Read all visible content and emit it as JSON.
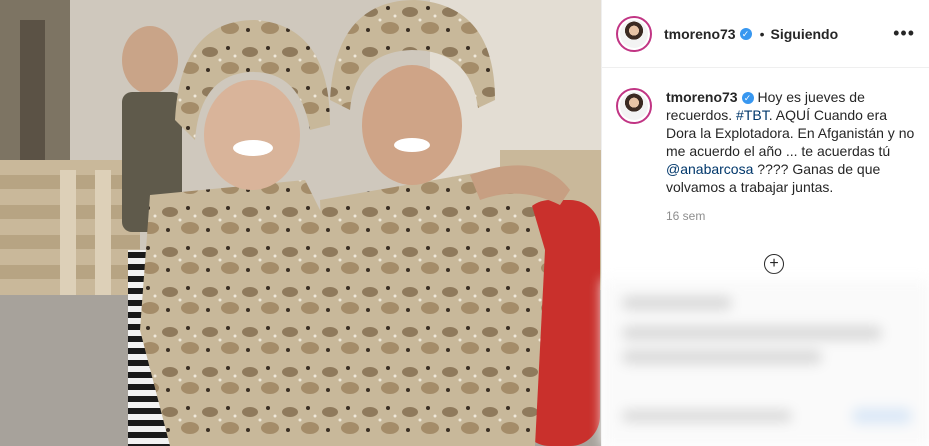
{
  "header": {
    "username": "tmoreno73",
    "verified_icon": "check-icon",
    "separator": "•",
    "follow_state": "Siguiendo",
    "more_label": "•••"
  },
  "caption": {
    "username": "tmoreno73",
    "text_1": " Hoy es jueves de recuerdos. ",
    "hashtag": "#TBT",
    "text_2": ". AQUÍ Cuando era Dora la Explotadora. En Afganistán y no me acuerdo el año ... te acuerdas tú ",
    "mention": "@anabarcosa",
    "text_3": " ???? Ganas de que volvamos a trabajar juntas.",
    "time": "16 sem"
  },
  "actions": {
    "plus_label": "+"
  },
  "colors": {
    "link": "#00376b",
    "verified": "#3897f0",
    "avatar_ring": "#c13584",
    "muted": "#8e8e8e"
  }
}
